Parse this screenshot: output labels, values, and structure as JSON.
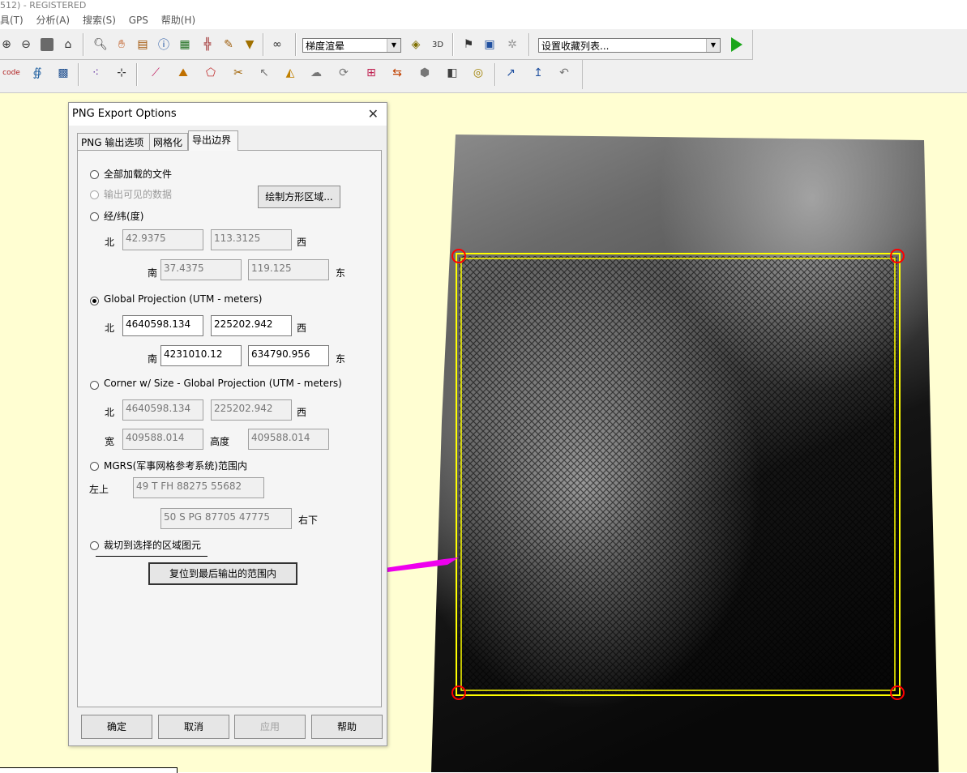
{
  "window": {
    "title": "512) - REGISTERED"
  },
  "menu": [
    "具(T)",
    "分析(A)",
    "搜索(S)",
    "GPS",
    "帮助(H)"
  ],
  "toolbar": {
    "shader_combo": "梯度渲晕",
    "favorites_combo": "设置收藏列表...",
    "icons_row1": [
      "zoom-in-icon",
      "zoom-out-icon",
      "gray-box-icon",
      "home-icon",
      "magnify-icon",
      "pan-hand-icon",
      "ruler-icon",
      "info-icon",
      "chart-icon",
      "tower-icon",
      "pen-icon",
      "dropdown-triangle-icon",
      "binoculars-icon",
      "layers-icon",
      "3d-icon",
      "flag-icon",
      "export-icon",
      "grid-icon",
      "play-icon"
    ],
    "icons_row2": [
      "code-icon",
      "lasso-icon",
      "mesh-icon",
      "dots-icon",
      "vertex-icon",
      "line-edit-icon",
      "area-edit-icon",
      "poly-edit-icon",
      "cut-icon",
      "arrow-icon",
      "shape-icon",
      "cloud-icon",
      "rotate-icon",
      "select-icon",
      "multi-icon",
      "cluster-icon",
      "fill-icon",
      "contour-icon",
      "undo-arrow-icon",
      "up-arrow-icon",
      "redo-icon"
    ]
  },
  "dialog": {
    "title": "PNG Export Options",
    "close": "✕",
    "tabs": [
      "PNG 输出选项",
      "网格化",
      "导出边界"
    ],
    "options": {
      "all_loaded": "全部加载的文件",
      "visible_data": "输出可见的数据",
      "draw_rect": "绘制方形区域...",
      "latlon": "经/纬(度)",
      "utm": "Global Projection (UTM - meters)",
      "corner": "Corner w/ Size - Global Projection (UTM - meters)",
      "mgrs": "MGRS(军事网格参考系统)范围内",
      "crop": "裁切到选择的区域图元"
    },
    "labels": {
      "north": "北",
      "south": "南",
      "west": "西",
      "east": "东",
      "width": "宽",
      "height": "高度",
      "top_left": "左上",
      "bottom_right": "右下"
    },
    "latlon": {
      "north": "42.9375",
      "west": "113.3125",
      "south": "37.4375",
      "east": "119.125"
    },
    "utm": {
      "north": "4640598.134",
      "west": "225202.942",
      "south": "4231010.12",
      "east": "634790.956"
    },
    "corner": {
      "north": "4640598.134",
      "west": "225202.942",
      "width": "409588.014",
      "height": "409588.014"
    },
    "mgrs": {
      "top_left": "49 T FH 88275 55682",
      "bottom_right": "50 S PG 87705 47775"
    },
    "reset_button": "复位到最后输出的范围内",
    "buttons": {
      "ok": "确定",
      "cancel": "取消",
      "apply": "应用",
      "help": "帮助"
    }
  },
  "colors": {
    "map_background": "#fffed2",
    "selection_border": "#ffff00",
    "corner_marker": "#ff0000",
    "annotation_arrow": "#ee00ee"
  }
}
